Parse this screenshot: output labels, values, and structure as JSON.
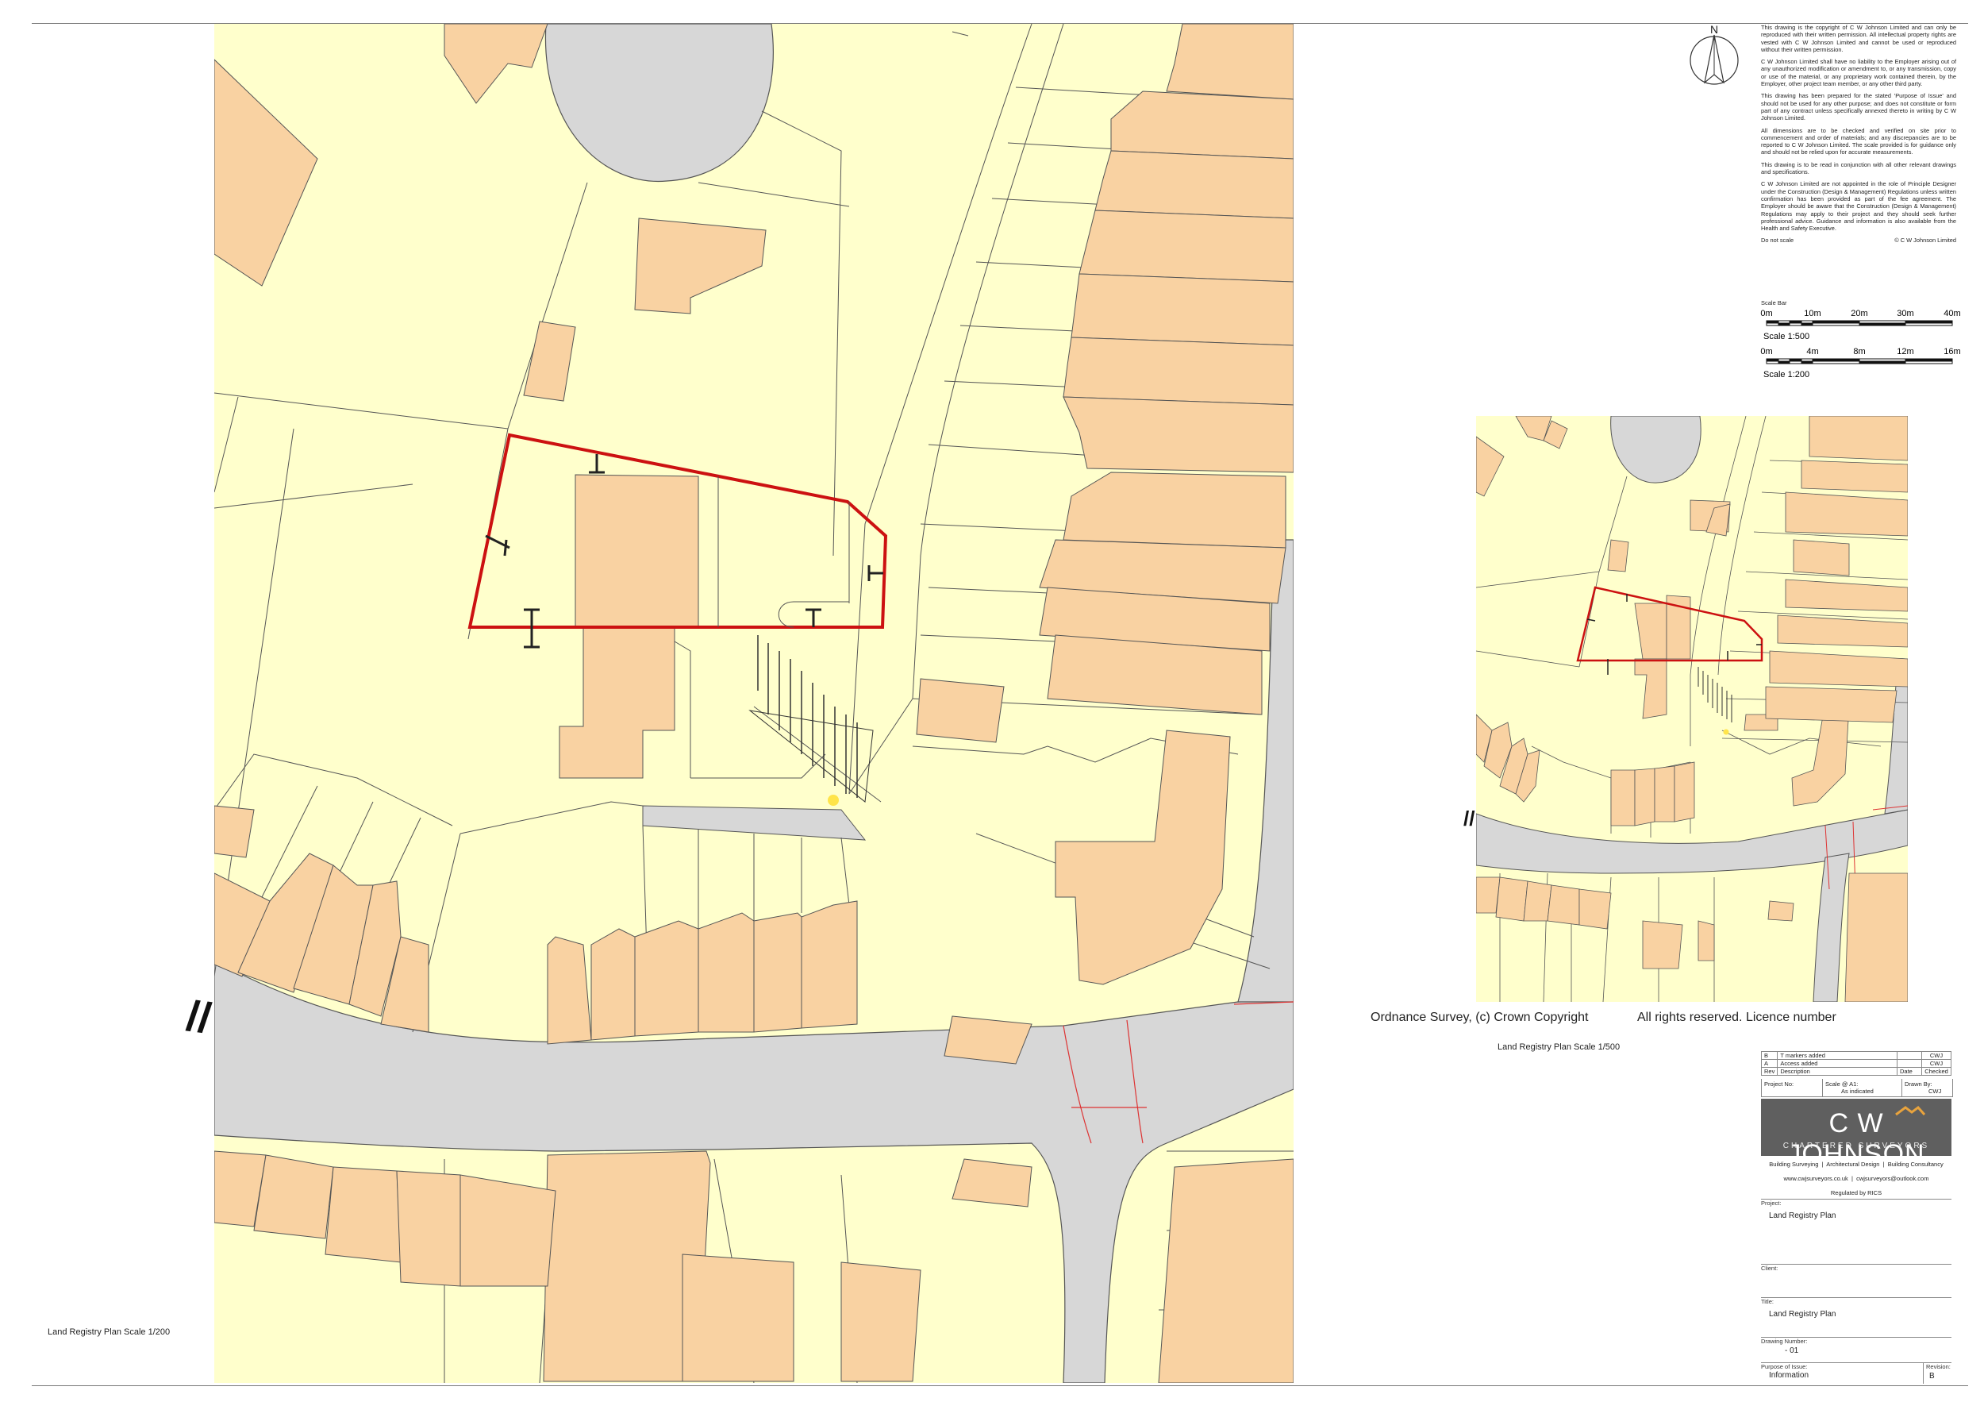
{
  "north_label": "N",
  "notes": [
    "This drawing is the copyright of C W Johnson Limited and can only be reproduced with their written permission. All intellectual property rights are vested with C W Johnson Limited and cannot be used or reproduced without their written permission.",
    "C W Johnson Limited shall have no liability to the Employer arising out of any unauthorized modification or amendment to, or any transmission, copy or use of the material, or any proprietary work contained therein, by the Employer, other project team member, or any other third party.",
    "This drawing has been prepared for the stated 'Purpose of Issue' and should not be used for any other purpose; and does not constitute or form part of any contract unless specifically annexed thereto in writing by C W Johnson Limited.",
    "All dimensions are to be checked and verified on site prior to commencement and order of materials; and any discrepancies are to be reported to C W Johnson Limited. The scale provided is for guidance only and should not be relied upon for accurate measurements.",
    "This drawing is to be read in conjunction with all other relevant drawings and specifications.",
    "C W Johnson Limited are not appointed in the role of Principle Designer under the Construction (Design & Management) Regulations unless written confirmation has been provided as part of the fee agreement. The Employer should be aware that the Construction (Design & Management) Regulations may apply to their project and they should seek further professional advice. Guidance and information is also available from the Health and Safety Executive."
  ],
  "do_not_scale": "Do not scale",
  "copyright": "© C W Johnson Limited",
  "scale_bar": {
    "title": "Scale Bar",
    "bar1": {
      "ticks": [
        "0m",
        "10m",
        "20m",
        "30m",
        "40m"
      ],
      "scale": "Scale 1:500"
    },
    "bar2": {
      "ticks": [
        "0m",
        "4m",
        "8m",
        "12m",
        "16m"
      ],
      "scale": "Scale 1:200"
    }
  },
  "os_text": "Ordnance Survey, (c) Crown Copyright",
  "rights_text": "All rights reserved. Licence number",
  "inset_caption": "Land Registry Plan Scale 1/500",
  "main_caption": "Land Registry Plan Scale 1/200",
  "break_mark": "//",
  "revisions": [
    {
      "rev": "B",
      "desc": "T markers added",
      "date": "",
      "checked": "CWJ"
    },
    {
      "rev": "A",
      "desc": "Access added",
      "date": "",
      "checked": "CWJ"
    }
  ],
  "rev_header": {
    "rev": "Rev",
    "desc": "Description",
    "date": "Date",
    "checked": "Checked"
  },
  "project_row": {
    "project_no_label": "Project No:",
    "scale_label": "Scale @ A1:",
    "scale_value": "As indicated",
    "drawn_by_label": "Drawn By:",
    "drawn_by_value": "CWJ"
  },
  "company": {
    "name": "C W JOHNSON",
    "sub": "CHARTERED SURVEYORS",
    "services": [
      "Building Surveying",
      "Architectural Design",
      "Building Consultancy"
    ],
    "website": "www.cwjsurveyors.co.uk",
    "email": "cwjsurveyors@outlook.com",
    "regulated": "Regulated by RICS",
    "accent": "#e8a33d"
  },
  "title_block": {
    "project_label": "Project:",
    "project_value": "Land Registry Plan",
    "client_label": "Client:",
    "client_value": "",
    "title_label": "Title:",
    "title_value": "Land Registry Plan",
    "drawing_number_label": "Drawing Number:",
    "drawing_number_value": "- 01",
    "purpose_label": "Purpose of Issue:",
    "purpose_value": "Information",
    "revision_label": "Revision:",
    "revision_value": "B"
  },
  "colors": {
    "land": "#ffffcc",
    "building": "#f9d2a2",
    "road": "#d7d7d7",
    "boundary": "#cc1111"
  }
}
